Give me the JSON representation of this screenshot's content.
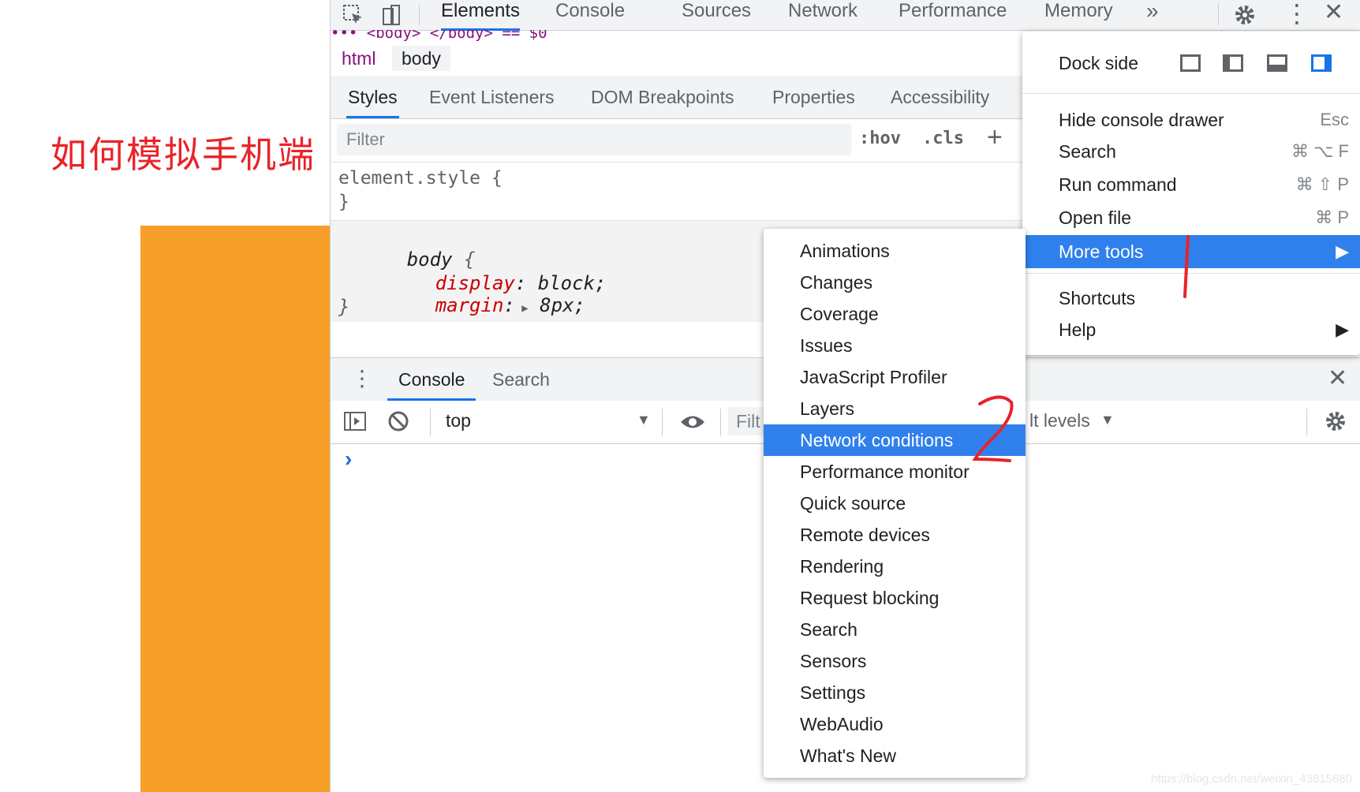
{
  "page": {
    "title": "如何模拟手机端",
    "watermark": "https://blog.csdn.net/weixin_43815680"
  },
  "devtools": {
    "top_tabs": [
      "Elements",
      "Console",
      "Sources",
      "Network",
      "Performance",
      "Memory"
    ],
    "more_tabs_glyph": "»",
    "dom_crumbline": "••• <body>  </body>  == $0",
    "breadcrumb": [
      "html",
      "body"
    ],
    "sub_tabs": [
      "Styles",
      "Event Listeners",
      "DOM Breakpoints",
      "Properties",
      "Accessibility"
    ],
    "filter_placeholder": "Filter",
    "hov": ":hov",
    "cls": ".cls",
    "add_glyph": "+",
    "rules": {
      "element_style_open": "element.style {",
      "element_style_close": "}",
      "body_selector": "body",
      "body_open_brace": " {",
      "prop1_name": "display",
      "prop1_value": " block;",
      "prop2_name": "margin",
      "prop2_value": " 8px;",
      "body_close": "}"
    },
    "drawer_tabs": [
      "Console",
      "Search"
    ],
    "console_context": "top",
    "console_filter": "Filt",
    "levels": "lt levels",
    "prompt_glyph": "›"
  },
  "main_menu": {
    "dock_side_label": "Dock side",
    "items": [
      {
        "label": "Hide console drawer",
        "shortcut": "Esc"
      },
      {
        "label": "Search",
        "shortcut": "⌘ ⌥ F"
      },
      {
        "label": "Run command",
        "shortcut": "⌘ ⇧ P"
      },
      {
        "label": "Open file",
        "shortcut": "⌘ P"
      },
      {
        "label": "More tools",
        "shortcut": "▶"
      },
      {
        "label": "Shortcuts",
        "shortcut": ""
      },
      {
        "label": "Help",
        "shortcut": "▶"
      }
    ]
  },
  "more_tools_menu": {
    "items": [
      "Animations",
      "Changes",
      "Coverage",
      "Issues",
      "JavaScript Profiler",
      "Layers",
      "Network conditions",
      "Performance monitor",
      "Quick source",
      "Remote devices",
      "Rendering",
      "Request blocking",
      "Search",
      "Sensors",
      "Settings",
      "WebAudio",
      "What's New"
    ],
    "highlighted": "Network conditions"
  },
  "colors": {
    "accent": "#1a73e8",
    "menu_highlight": "#2f80ed",
    "annotation_red": "#e8232a",
    "orange_block": "#f79f28"
  }
}
